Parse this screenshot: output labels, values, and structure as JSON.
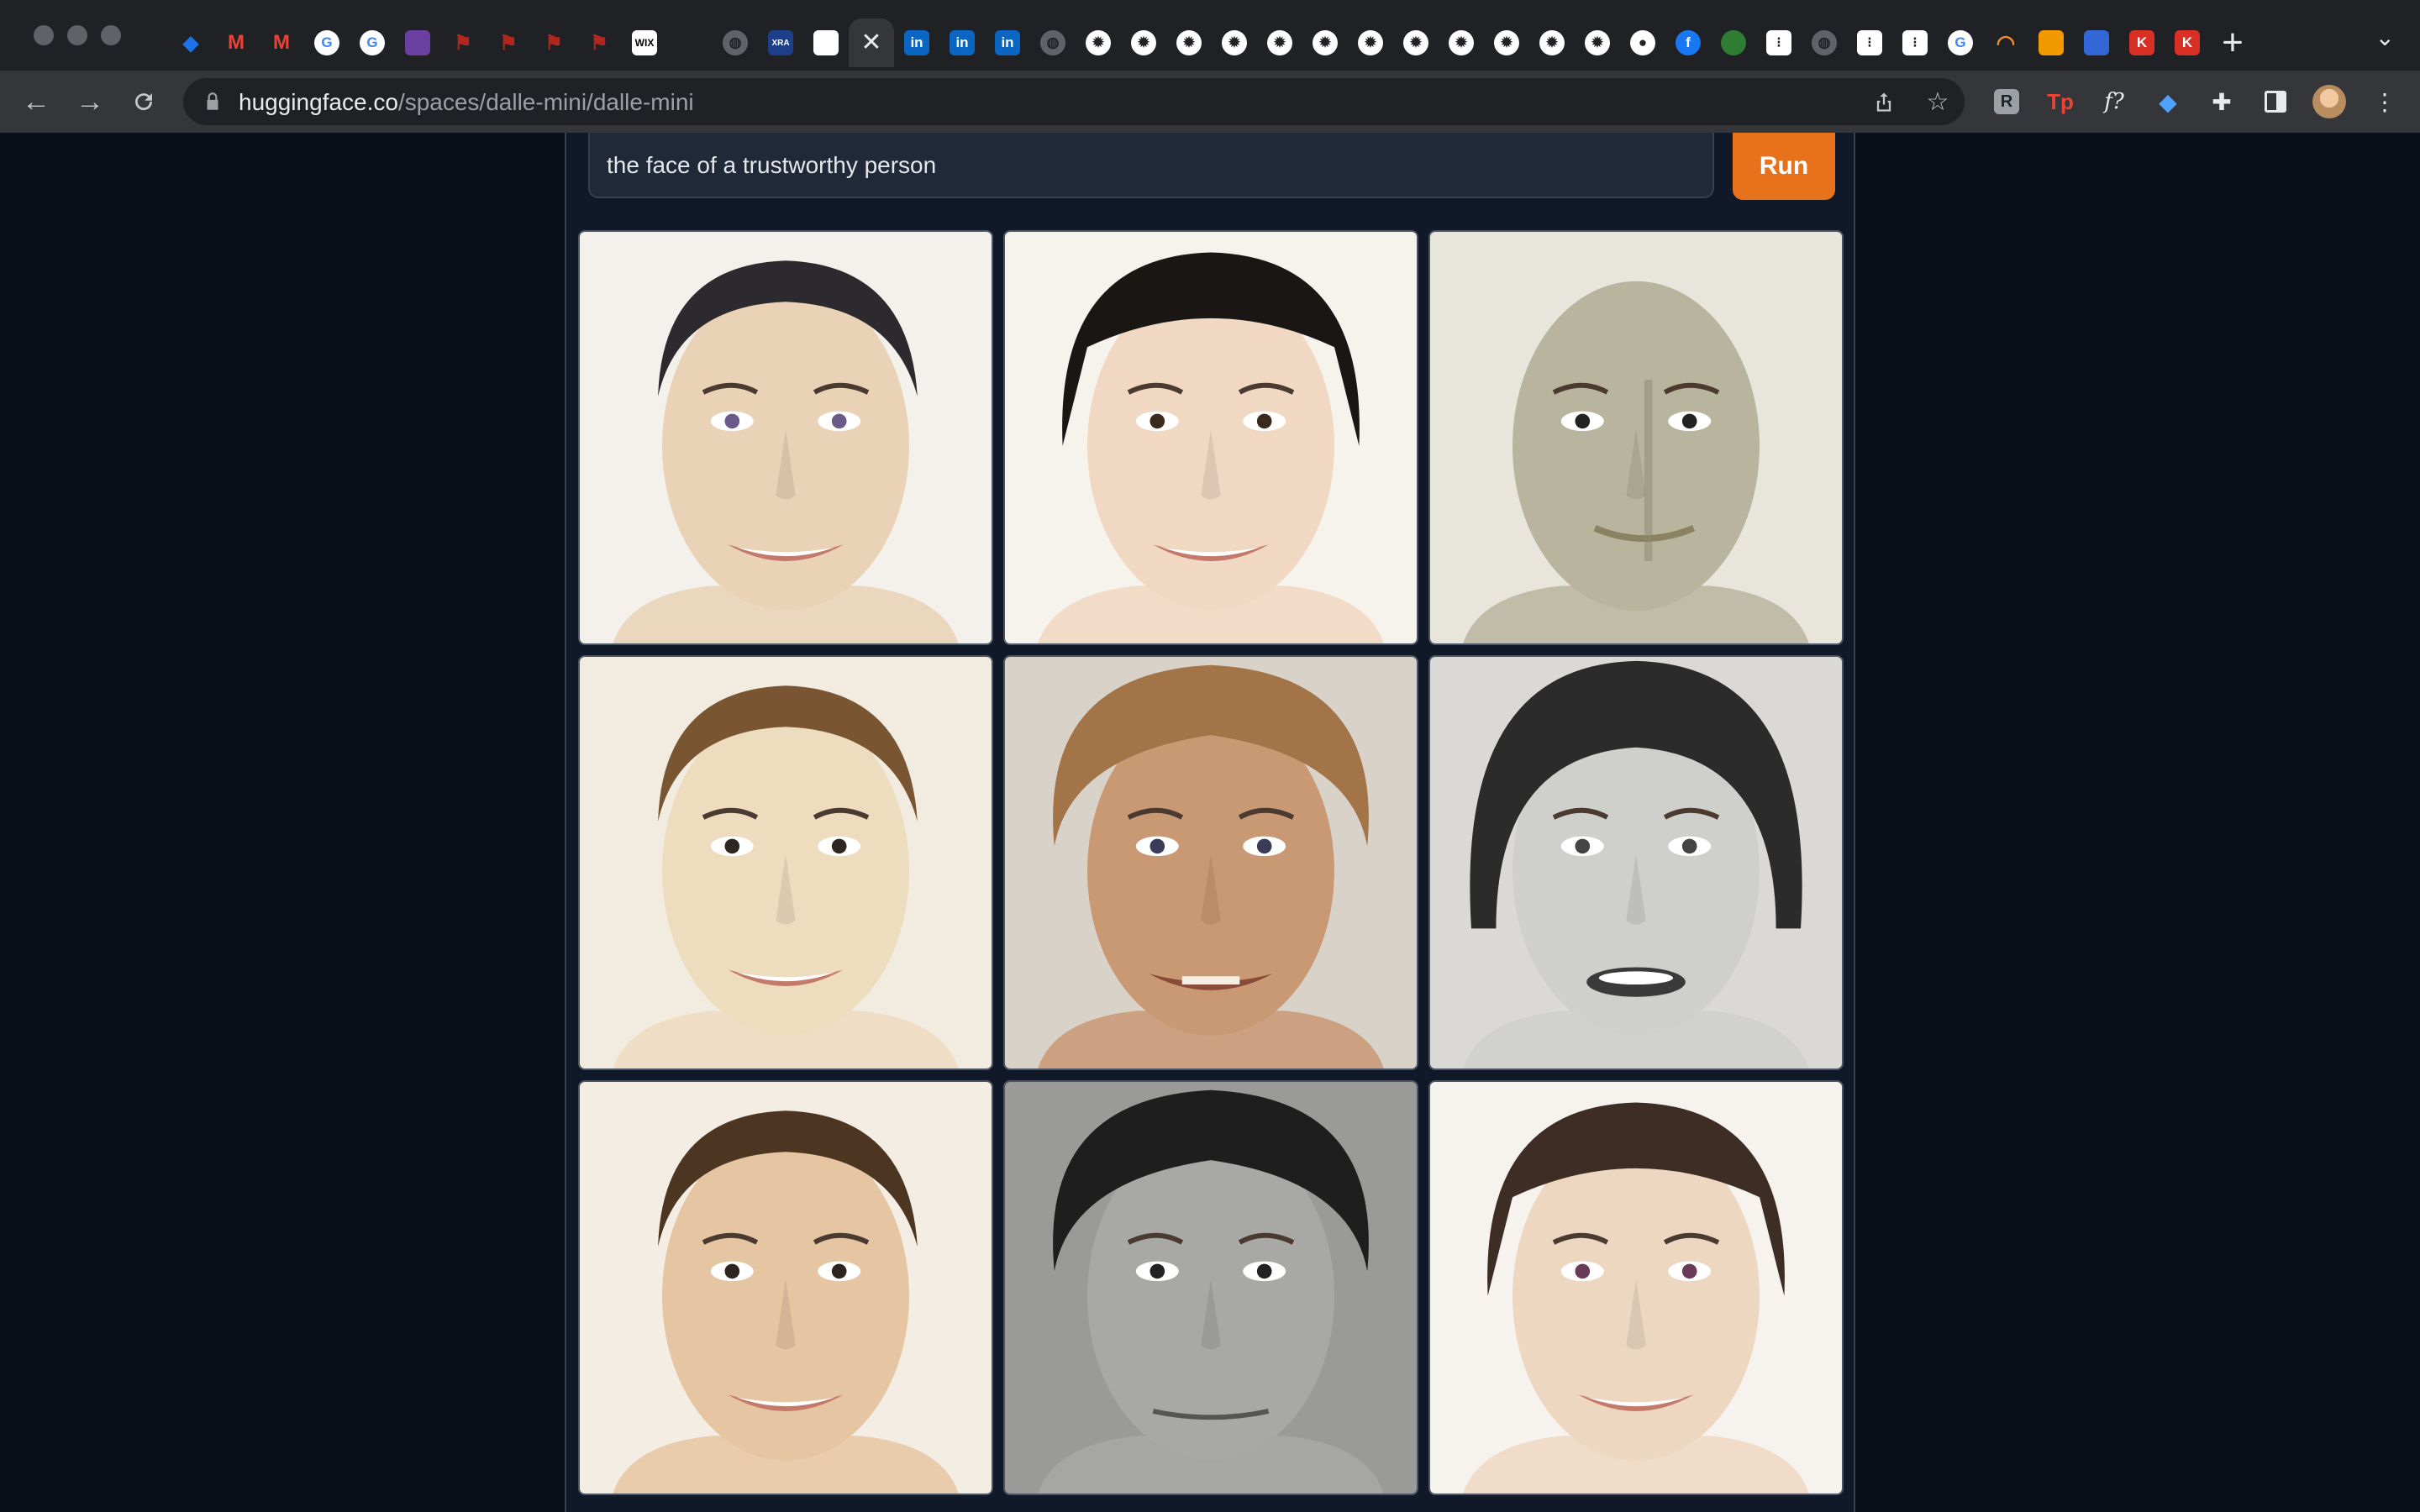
{
  "browser": {
    "url_host": "huggingface.co",
    "url_path": "/spaces/dalle-mini/dalle-mini",
    "tabs": [
      {
        "icon": "diamond-icon",
        "color": "#1a73e8"
      },
      {
        "icon": "gmail-icon",
        "color": "#ea4335"
      },
      {
        "icon": "gmail-icon",
        "color": "#ea4335"
      },
      {
        "icon": "google-icon",
        "color": "#ffffff"
      },
      {
        "icon": "google-icon",
        "color": "#ffffff"
      },
      {
        "icon": "purple-app-icon",
        "color": "#6b3fa0"
      },
      {
        "icon": "red-flag-icon",
        "color": "#b3261e"
      },
      {
        "icon": "red-flag-icon",
        "color": "#b3261e"
      },
      {
        "icon": "red-flag-icon",
        "color": "#b3261e"
      },
      {
        "icon": "red-flag-icon",
        "color": "#b3261e"
      },
      {
        "icon": "wix-icon",
        "color": "#ffffff",
        "text": "WIX"
      },
      {
        "icon": "blank-tab-icon",
        "color": "#202124"
      },
      {
        "icon": "globe-icon",
        "color": "#9aa0a6"
      },
      {
        "icon": "xra-icon",
        "color": "#1d3f8a",
        "text": "XRA"
      },
      {
        "icon": "white-page-icon",
        "color": "#ffffff"
      },
      {
        "icon": "close-icon",
        "color": "#35363a",
        "active": true
      },
      {
        "icon": "linkedin-icon",
        "color": "#0a66c2",
        "text": "in"
      },
      {
        "icon": "linkedin-icon",
        "color": "#0a66c2",
        "text": "in"
      },
      {
        "icon": "linkedin-icon",
        "color": "#0a66c2",
        "text": "in"
      },
      {
        "icon": "globe-icon",
        "color": "#9aa0a6"
      },
      {
        "icon": "gear-icon",
        "color": "#ffffff"
      },
      {
        "icon": "gear-icon",
        "color": "#ffffff"
      },
      {
        "icon": "gear-icon",
        "color": "#ffffff"
      },
      {
        "icon": "gear-icon",
        "color": "#ffffff"
      },
      {
        "icon": "gear-icon",
        "color": "#ffffff"
      },
      {
        "icon": "gear-icon",
        "color": "#ffffff"
      },
      {
        "icon": "gear-icon",
        "color": "#ffffff"
      },
      {
        "icon": "gear-icon",
        "color": "#ffffff"
      },
      {
        "icon": "gear-icon",
        "color": "#ffffff"
      },
      {
        "icon": "gear-icon",
        "color": "#ffffff"
      },
      {
        "icon": "gear-icon",
        "color": "#ffffff"
      },
      {
        "icon": "gear-icon",
        "color": "#ffffff"
      },
      {
        "icon": "github-icon",
        "color": "#ffffff"
      },
      {
        "icon": "facebook-icon",
        "color": "#1877f2"
      },
      {
        "icon": "green-app-icon",
        "color": "#2e7d32"
      },
      {
        "icon": "dots-icon",
        "color": "#ffffff"
      },
      {
        "icon": "globe-icon",
        "color": "#9aa0a6"
      },
      {
        "icon": "dots-icon",
        "color": "#ffffff"
      },
      {
        "icon": "dots-icon",
        "color": "#ffffff"
      },
      {
        "icon": "google-icon",
        "color": "#ffffff"
      },
      {
        "icon": "orange-arc-icon",
        "color": "#f28b30"
      },
      {
        "icon": "orange-book-icon",
        "color": "#f29900"
      },
      {
        "icon": "blue-m-icon",
        "color": "#3367d6"
      },
      {
        "icon": "red-k-icon",
        "color": "#d93025",
        "text": "K"
      },
      {
        "icon": "red-k-icon",
        "color": "#d93025",
        "text": "K"
      }
    ],
    "extensions": [
      {
        "icon": "readwise-icon"
      },
      {
        "icon": "tp-icon",
        "text": "Tp"
      },
      {
        "icon": "function-icon",
        "text": "f?"
      },
      {
        "icon": "diamond-ext-icon"
      },
      {
        "icon": "puzzle-icon"
      },
      {
        "icon": "sidepanel-icon"
      },
      {
        "icon": "profile-avatar-icon"
      },
      {
        "icon": "kebab-menu-icon"
      }
    ]
  },
  "app": {
    "prompt_value": "the face of a trustworthy person",
    "run_label": "Run",
    "accent_color": "#e8711c",
    "images": [
      {
        "desc": "face-1"
      },
      {
        "desc": "face-2"
      },
      {
        "desc": "face-3"
      },
      {
        "desc": "face-4"
      },
      {
        "desc": "face-5"
      },
      {
        "desc": "face-6"
      },
      {
        "desc": "face-7"
      },
      {
        "desc": "face-8"
      },
      {
        "desc": "face-9"
      }
    ]
  }
}
